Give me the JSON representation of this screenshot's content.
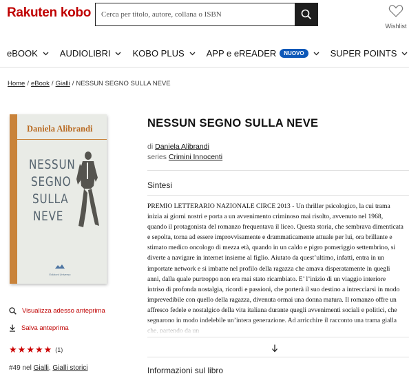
{
  "header": {
    "logo_brand": "Rakuten",
    "logo_product": "kobo",
    "search_placeholder": "Cerca per titolo, autore, collana o ISBN",
    "wishlist_label": "Wishlist"
  },
  "nav": {
    "items": [
      {
        "label": "eBOOK"
      },
      {
        "label": "AUDIOLIBRI"
      },
      {
        "label": "KOBO PLUS"
      },
      {
        "label": "APP e eREADER",
        "badge": "NUOVO"
      },
      {
        "label": "SUPER POINTS"
      }
    ]
  },
  "breadcrumb": {
    "home": "Home",
    "ebook": "eBook",
    "gialli": "Gialli",
    "current": "NESSUN SEGNO SULLA NEVE"
  },
  "cover": {
    "author": "Daniela Alibrandi",
    "title_lines": [
      "NESSUN",
      "SEGNO",
      "SULLA",
      "NEVE"
    ],
    "publisher": "Edizioni Universo"
  },
  "actions": {
    "preview": "Visualizza adesso anteprima",
    "save_preview": "Salva anteprima"
  },
  "rating": {
    "stars": 5,
    "count": "(1)"
  },
  "rank": {
    "position": "#49",
    "in": "nel",
    "category1": "Gialli",
    "category2": "Gialli storici"
  },
  "book": {
    "title": "NESSUN SEGNO SULLA NEVE",
    "by": "di",
    "author": "Daniela Alibrandi",
    "series_label": "series",
    "series": "Crimini Innocenti"
  },
  "synopsis": {
    "heading": "Sintesi",
    "text": "PREMIO LETTERARIO NAZIONALE CIRCE 2013 - Un thriller psicologico, la cui trama inizia ai giorni nostri e porta a un avvenimento criminoso mai risolto, avvenuto nel 1968, quando il protagonista del romanzo frequentava il liceo. Questa storia, che sembrava dimenticata e sepolta, torna ad essere improvvisamente e drammaticamente attuale per lui, ora brillante e stimato medico oncologo di mezza età, quando in un caldo e pigro pomeriggio settembrino, si diverte a navigare in internet insieme al figlio. Aiutato da quest’ultimo, infatti, entra in un importate network e si imbatte nel profilo della ragazza che amava disperatamente in quegli anni, dalla quale purtroppo non era mai stato ricambiato. E’ l’inizio di un viaggio interiore intriso di profonda nostalgia, ricordi e passioni, che porterà il suo destino a intrecciarsi in modo imprevedibile con quello della ragazza, divenuta ormai una donna matura. Il romanzo offre un affresco fedele e nostalgico della vita italiana durante quegli avvenimenti sociali e politici, che segnarono in modo indelebile un’intera generazione. Ad arricchire il racconto una trama gialla che, partendo da un"
  },
  "info": {
    "heading": "Informazioni sul libro"
  },
  "colors": {
    "brand": "#bf0000",
    "badge": "#0d58b8",
    "cover_accent": "#c9833a",
    "cover_bg": "#e9ebe6"
  }
}
